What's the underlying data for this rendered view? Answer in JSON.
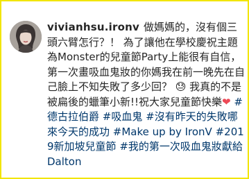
{
  "post": {
    "username": "vivianhsu.ironv",
    "caption_text": "做媽媽的，沒有個三頭六臂怎行？！ 為了讓他在學校慶祝主題為Monster的兒童節Party上能很有自信，第一次畫吸血鬼妝的你媽我在前一晚先在自己臉上不知失敗了多少回？ 😓 我真的不是被扁後的蠟筆小新!!祝大家兒童節快樂",
    "heart_emoji": "❤",
    "tags": [
      {
        "text": "#德古拉伯爵"
      },
      {
        "text": "#吸血鬼"
      },
      {
        "text": "#沒有昨天的失敗哪來今天的成功"
      },
      {
        "text": "#Make up by IronV"
      },
      {
        "text": "#2019新加坡兒童節"
      },
      {
        "text": "#我的第一次吸血鬼妝獻給Dalton"
      }
    ]
  },
  "colors": {
    "frame": "#f2e500",
    "text": "#262626",
    "hashtag": "#00376b",
    "heart": "#ed4956"
  }
}
